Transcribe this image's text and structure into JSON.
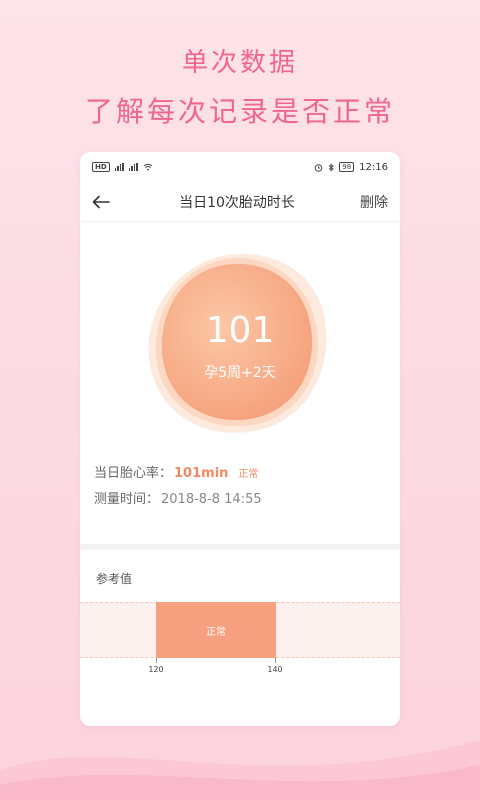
{
  "promo": {
    "title1": "单次数据",
    "title2": "了解每次记录是否正常"
  },
  "status_bar": {
    "hd": "HD",
    "battery": "98",
    "time": "12:16"
  },
  "nav": {
    "title": "当日10次胎动时长",
    "delete_label": "删除"
  },
  "metric": {
    "value": "101",
    "pregnancy": "孕5周+2天"
  },
  "info": {
    "heart_rate_label": "当日胎心率：",
    "heart_rate_value": "101min",
    "heart_rate_status": "正常",
    "time_label": "测量时间：",
    "time_value": "2018-8-8  14:55"
  },
  "reference": {
    "title": "参考值",
    "normal_label": "正常",
    "low": "120",
    "high": "140"
  },
  "colors": {
    "accent_pink": "#f0668c",
    "accent_orange": "#ef8a60",
    "normal_band": "#f6a07f"
  },
  "icons": {
    "back": "back-arrow-icon",
    "alarm": "alarm-icon",
    "bluetooth": "bluetooth-icon",
    "wifi": "wifi-icon"
  }
}
